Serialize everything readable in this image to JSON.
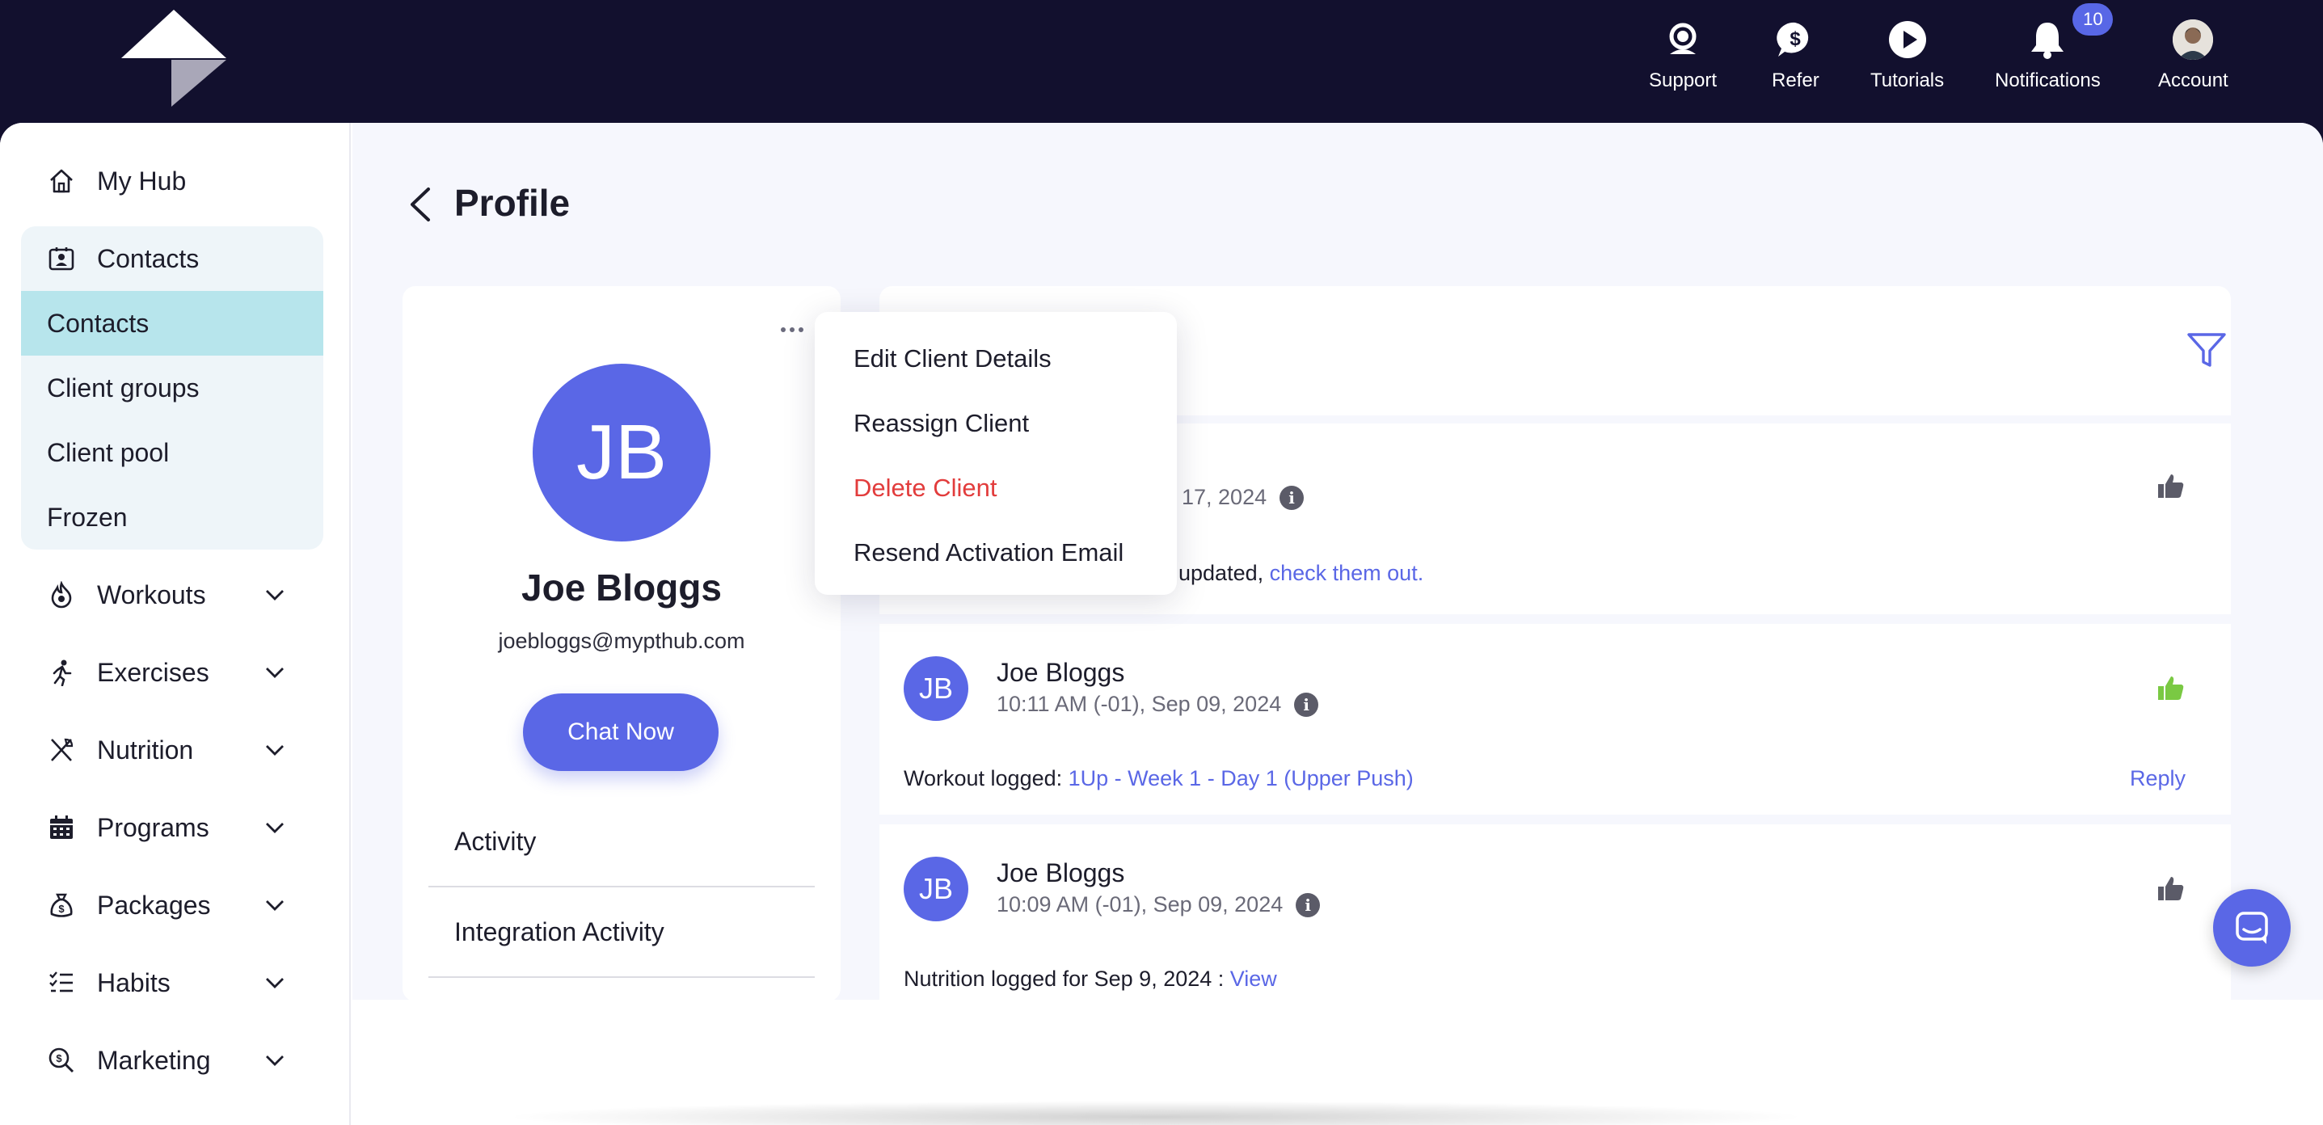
{
  "topnav": {
    "support": "Support",
    "refer": "Refer",
    "tutorials": "Tutorials",
    "notifications": "Notifications",
    "notifications_count": "10",
    "account": "Account"
  },
  "sidebar": {
    "my_hub": "My Hub",
    "contacts": "Contacts",
    "contacts_sub": [
      "Contacts",
      "Client groups",
      "Client pool",
      "Frozen"
    ],
    "workouts": "Workouts",
    "exercises": "Exercises",
    "nutrition": "Nutrition",
    "programs": "Programs",
    "packages": "Packages",
    "habits": "Habits",
    "marketing": "Marketing"
  },
  "page": {
    "title": "Profile"
  },
  "profile": {
    "initials": "JB",
    "name": "Joe Bloggs",
    "email": "joebloggs@mypthub.com",
    "chat_button": "Chat Now",
    "links": [
      "Activity",
      "Integration Activity"
    ]
  },
  "menu": {
    "items": [
      "Edit Client Details",
      "Reassign Client",
      "Delete Client",
      "Resend Activation Email"
    ]
  },
  "feed": [
    {
      "time_partial": "17, 2024",
      "body_partial": "updated, ",
      "link": "check them out."
    },
    {
      "initials": "JB",
      "name": "Joe Bloggs",
      "time": "10:11 AM (-01), Sep 09, 2024",
      "body_prefix": "Workout logged: ",
      "link": "1Up - Week 1 - Day 1 (Upper Push)",
      "reply": "Reply"
    },
    {
      "initials": "JB",
      "name": "Joe Bloggs",
      "time": "10:09 AM (-01), Sep 09, 2024",
      "body_prefix": "Nutrition logged for Sep 9, 2024 : ",
      "link": "View"
    }
  ],
  "colors": {
    "topbar": "#12102e",
    "accent": "#5a67e6",
    "danger": "#e23c3c",
    "active_sub": "#b7e5ec",
    "thumb_active": "#7ac943"
  }
}
